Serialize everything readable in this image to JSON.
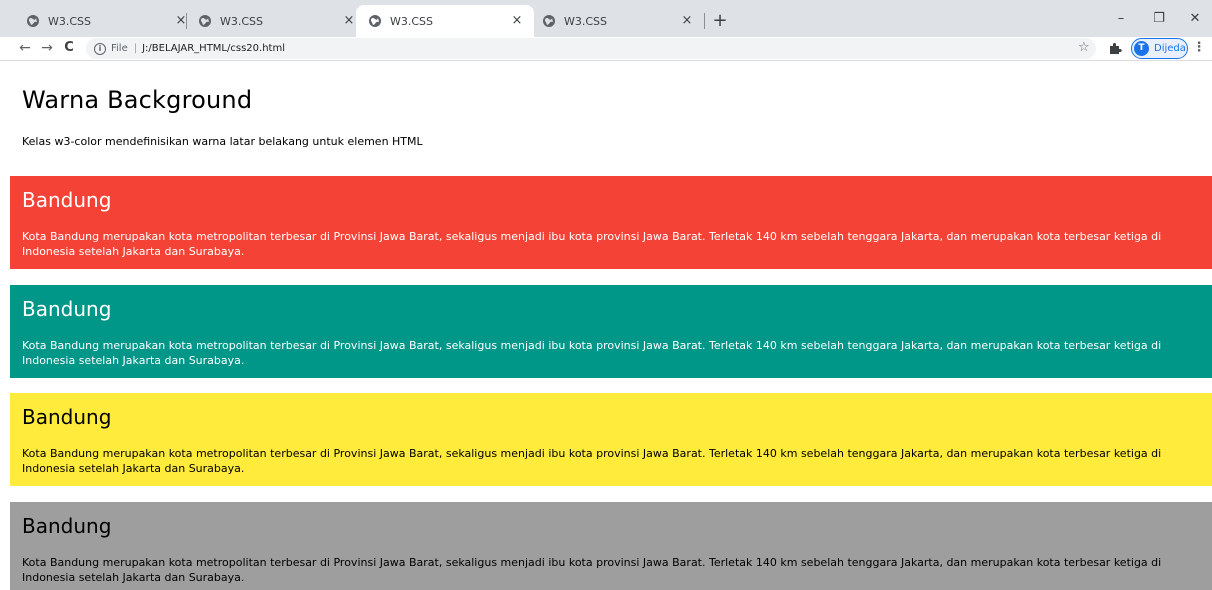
{
  "browser": {
    "tabs": [
      {
        "title": "W3.CSS",
        "active": false
      },
      {
        "title": "W3.CSS",
        "active": false
      },
      {
        "title": "W3.CSS",
        "active": true
      },
      {
        "title": "W3.CSS",
        "active": false
      }
    ],
    "close_glyph": "×",
    "new_tab_glyph": "+",
    "window": {
      "minimize": "–",
      "restore": "❐",
      "close": "✕"
    },
    "nav": {
      "back": "←",
      "forward": "→",
      "reload": "C"
    },
    "address": {
      "scheme": "File",
      "separator": "|",
      "url": "J:/BELAJAR_HTML/css20.html"
    },
    "profile": {
      "initial": "T",
      "name": "Dijeda"
    },
    "menu_glyph": "⋮",
    "star_glyph": "☆"
  },
  "page": {
    "title": "Warna Background",
    "description": "Kelas w3-color mendefinisikan warna latar belakang untuk elemen HTML",
    "panels": [
      {
        "heading": "Bandung",
        "text": "Kota Bandung merupakan kota metropolitan terbesar di Provinsi Jawa Barat, sekaligus menjadi ibu kota provinsi Jawa Barat. Terletak 140 km sebelah tenggara Jakarta, dan merupakan kota terbesar ketiga di Indonesia setelah Jakarta dan Surabaya.",
        "background": "#f44336",
        "color": "#ffffff"
      },
      {
        "heading": "Bandung",
        "text": "Kota Bandung merupakan kota metropolitan terbesar di Provinsi Jawa Barat, sekaligus menjadi ibu kota provinsi Jawa Barat. Terletak 140 km sebelah tenggara Jakarta, dan merupakan kota terbesar ketiga di Indonesia setelah Jakarta dan Surabaya.",
        "background": "#009688",
        "color": "#ffffff"
      },
      {
        "heading": "Bandung",
        "text": "Kota Bandung merupakan kota metropolitan terbesar di Provinsi Jawa Barat, sekaligus menjadi ibu kota provinsi Jawa Barat. Terletak 140 km sebelah tenggara Jakarta, dan merupakan kota terbesar ketiga di Indonesia setelah Jakarta dan Surabaya.",
        "background": "#ffeb3b",
        "color": "#000000"
      },
      {
        "heading": "Bandung",
        "text": "Kota Bandung merupakan kota metropolitan terbesar di Provinsi Jawa Barat, sekaligus menjadi ibu kota provinsi Jawa Barat. Terletak 140 km sebelah tenggara Jakarta, dan merupakan kota terbesar ketiga di Indonesia setelah Jakarta dan Surabaya.",
        "background": "#9e9e9e",
        "color": "#000000"
      }
    ]
  }
}
